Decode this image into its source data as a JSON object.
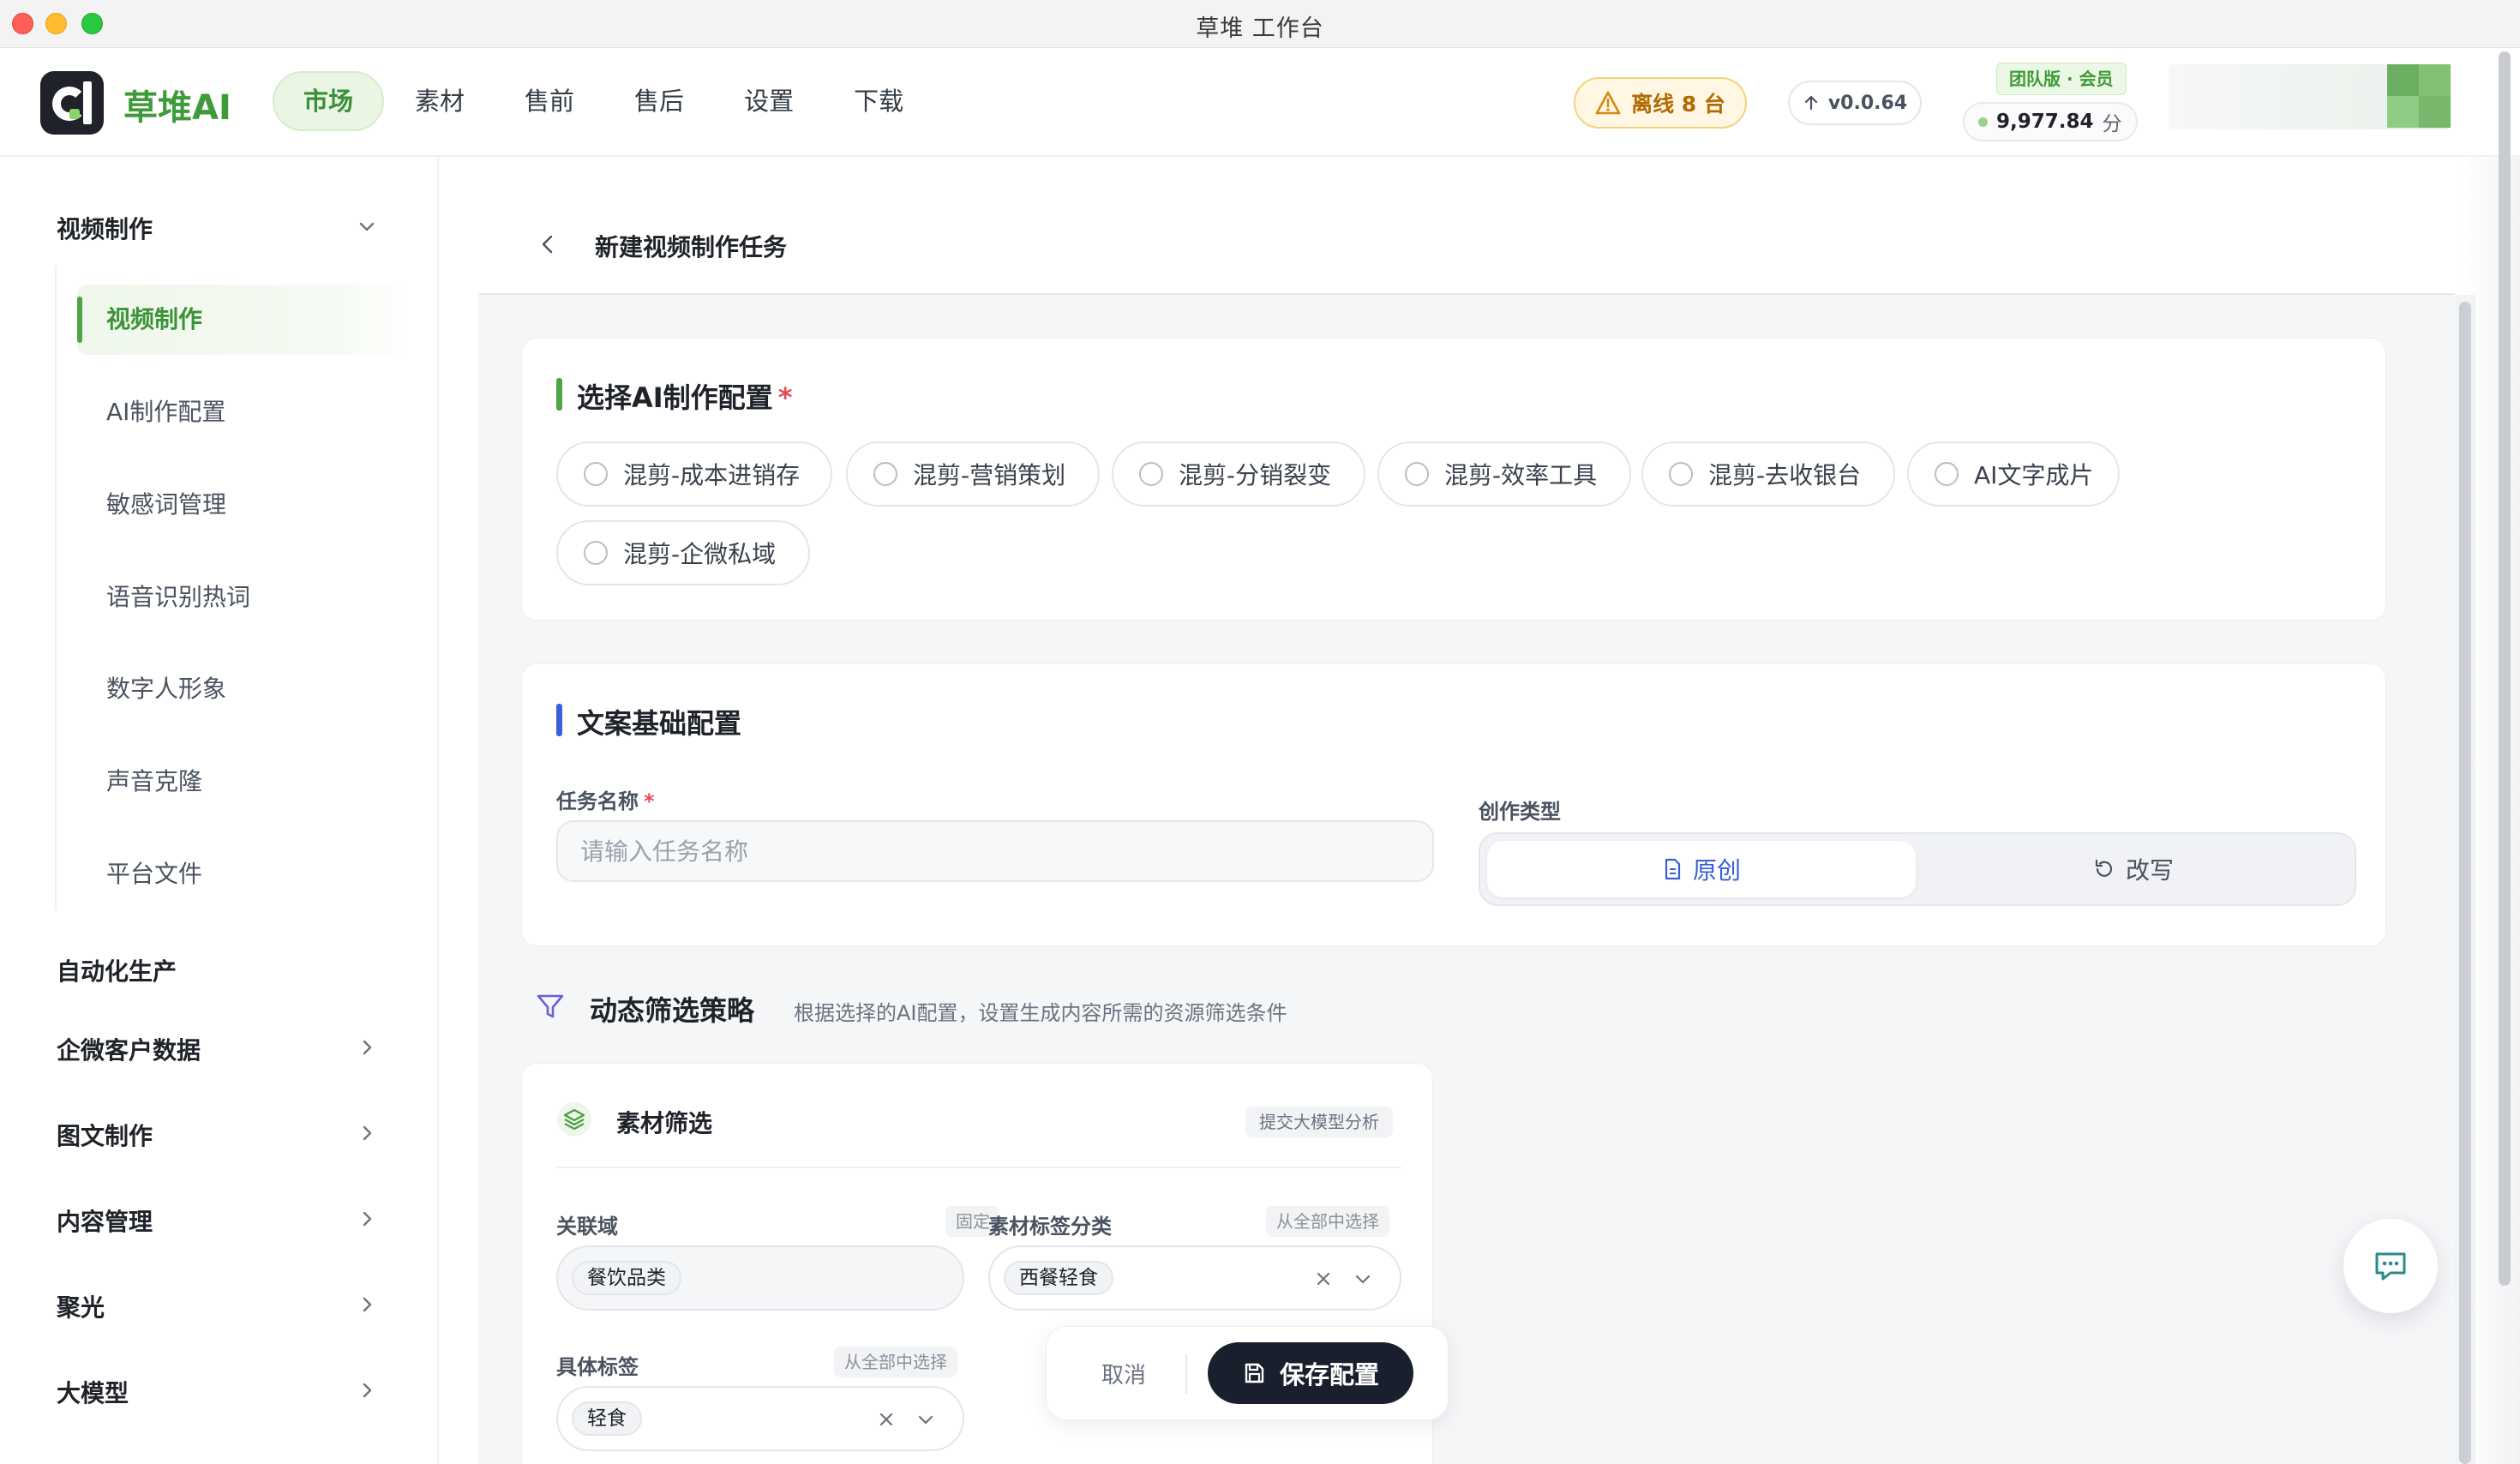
{
  "window": {
    "title": "草堆 工作台"
  },
  "brand": {
    "name": "草堆AI"
  },
  "nav": {
    "items": [
      {
        "label": "市场",
        "active": true
      },
      {
        "label": "素材",
        "active": false
      },
      {
        "label": "售前",
        "active": false
      },
      {
        "label": "售后",
        "active": false
      },
      {
        "label": "设置",
        "active": false
      },
      {
        "label": "下载",
        "active": false
      }
    ]
  },
  "header": {
    "alert_label": "离线 8 台",
    "version_label": "v0.0.64",
    "tier_label": "团队版 · 会员",
    "points_value": "9,977.84",
    "points_unit": "分"
  },
  "sidebar": {
    "group_video": "视频制作",
    "sub_items": [
      {
        "label": "视频制作",
        "active": true
      },
      {
        "label": "AI制作配置",
        "active": false
      },
      {
        "label": "敏感词管理",
        "active": false
      },
      {
        "label": "语音识别热词",
        "active": false
      },
      {
        "label": "数字人形象",
        "active": false
      },
      {
        "label": "声音克隆",
        "active": false
      },
      {
        "label": "平台文件",
        "active": false
      }
    ],
    "groups": [
      {
        "label": "自动化生产",
        "has_chevron": false
      },
      {
        "label": "企微客户数据",
        "has_chevron": true
      },
      {
        "label": "图文制作",
        "has_chevron": true
      },
      {
        "label": "内容管理",
        "has_chevron": true
      },
      {
        "label": "聚光",
        "has_chevron": true
      },
      {
        "label": "大模型",
        "has_chevron": true
      }
    ]
  },
  "page": {
    "title": "新建视频制作任务"
  },
  "ai_config": {
    "title": "选择AI制作配置",
    "required_mark": "*",
    "options": [
      "混剪-成本进销存",
      "混剪-营销策划",
      "混剪-分销裂变",
      "混剪-效率工具",
      "混剪-去收银台",
      "AI文字成片",
      "混剪-企微私域"
    ]
  },
  "copy_config": {
    "title": "文案基础配置",
    "task_name_label": "任务名称",
    "required_mark": "*",
    "task_name_placeholder": "请输入任务名称",
    "task_name_value": "",
    "creation_type_label": "创作类型",
    "creation_types": [
      {
        "label": "原创",
        "active": true
      },
      {
        "label": "改写",
        "active": false
      }
    ]
  },
  "dynamic_filter": {
    "title": "动态筛选策略",
    "subtitle": "根据选择的AI配置，设置生成内容所需的资源筛选条件"
  },
  "material_filter": {
    "title": "素材筛选",
    "submit_tag": "提交大模型分析",
    "domain_label": "关联域",
    "domain_tag": "固定",
    "domain_value": "餐饮品类",
    "category_label": "素材标签分类",
    "category_tag": "从全部中选择",
    "category_value": "西餐轻食",
    "specific_label": "具体标签",
    "specific_tag": "从全部中选择",
    "specific_value": "轻食"
  },
  "actions": {
    "cancel_label": "取消",
    "save_label": "保存配置"
  },
  "colors": {
    "brand_green": "#3f9b3a",
    "accent_blue": "#3a5fd9",
    "warning": "#b26a00",
    "required": "#e34d59",
    "dark_button": "#1a1f2e"
  }
}
